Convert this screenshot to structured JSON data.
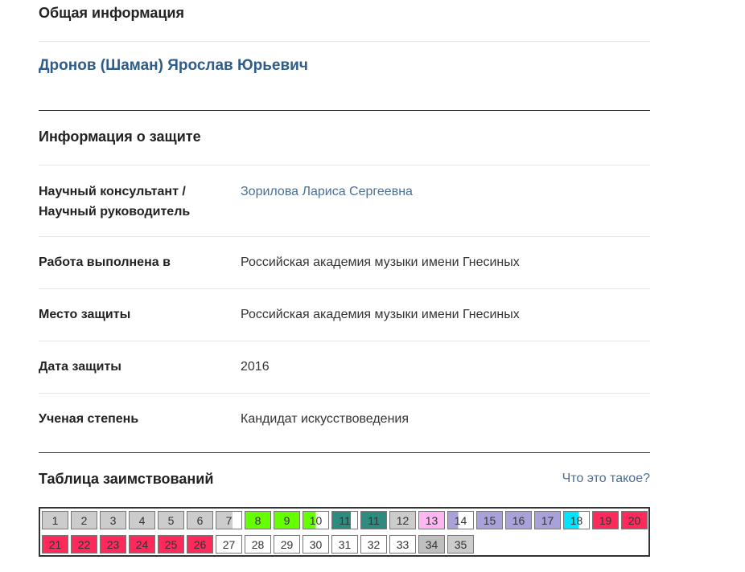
{
  "general": {
    "title": "Общая информация",
    "person_name": "Дронов (Шаман) Ярослав Юрьевич"
  },
  "defense": {
    "title": "Информация о защите",
    "rows": [
      {
        "label_1": "Научный консультант /",
        "label_2": "Научный руководитель",
        "value": "Зорилова Лариса Сергеевна",
        "is_link": true
      },
      {
        "label": "Работа выполнена в",
        "value": "Российская академия музыки имени Гнесиных"
      },
      {
        "label": "Место защиты",
        "value": "Российская академия музыки имени Гнесиных"
      },
      {
        "label": "Дата защиты",
        "value": "2016"
      },
      {
        "label": "Ученая степень",
        "value": "Кандидат искусствоведения"
      }
    ]
  },
  "borrowings": {
    "title": "Таблица заимствований",
    "help_link": "Что это такое?",
    "cells": [
      {
        "n": "1",
        "color": "#cccccc",
        "fill": 1
      },
      {
        "n": "2",
        "color": "#cccccc",
        "fill": 1
      },
      {
        "n": "3",
        "color": "#cccccc",
        "fill": 1
      },
      {
        "n": "4",
        "color": "#cccccc",
        "fill": 1
      },
      {
        "n": "5",
        "color": "#cccccc",
        "fill": 1
      },
      {
        "n": "6",
        "color": "#cccccc",
        "fill": 1
      },
      {
        "n": "7",
        "color": "#cccccc",
        "fill": 0.65
      },
      {
        "n": "8",
        "color": "#66ff00",
        "fill": 1
      },
      {
        "n": "9",
        "color": "#66ff00",
        "fill": 1
      },
      {
        "n": "10",
        "color": "#66ff00",
        "fill": 0.5
      },
      {
        "n": "11",
        "color": "#2e8b80",
        "fill": 0.75
      },
      {
        "n": "11",
        "color": "#2e8b80",
        "fill": 1
      },
      {
        "n": "12",
        "color": "#cccccc",
        "fill": 1
      },
      {
        "n": "13",
        "color": "#ffb6f2",
        "fill": 1
      },
      {
        "n": "14",
        "color": "#a9a1d9",
        "fill": 0.4
      },
      {
        "n": "15",
        "color": "#a9a1d9",
        "fill": 1
      },
      {
        "n": "16",
        "color": "#a9a1d9",
        "fill": 1
      },
      {
        "n": "17",
        "color": "#a9a1d9",
        "fill": 1
      },
      {
        "n": "18",
        "color": "#00e5ff",
        "fill": 0.6
      },
      {
        "n": "19",
        "color": "#ff2a5b",
        "fill": 1
      },
      {
        "n": "20",
        "color": "#ff2a5b",
        "fill": 1
      },
      {
        "n": "21",
        "color": "#ff2a5b",
        "fill": 1
      },
      {
        "n": "22",
        "color": "#ff2a5b",
        "fill": 1
      },
      {
        "n": "23",
        "color": "#ff2a5b",
        "fill": 1
      },
      {
        "n": "24",
        "color": "#ff2a5b",
        "fill": 1
      },
      {
        "n": "25",
        "color": "#ff2a5b",
        "fill": 1
      },
      {
        "n": "26",
        "color": "#ff2a5b",
        "fill": 1
      },
      {
        "n": "27",
        "color": "#ffffff",
        "fill": 0
      },
      {
        "n": "28",
        "color": "#ffffff",
        "fill": 0
      },
      {
        "n": "29",
        "color": "#ffffff",
        "fill": 0
      },
      {
        "n": "30",
        "color": "#ffffff",
        "fill": 0
      },
      {
        "n": "31",
        "color": "#ffffff",
        "fill": 0
      },
      {
        "n": "32",
        "color": "#ffffff",
        "fill": 0
      },
      {
        "n": "33",
        "color": "#ffffff",
        "fill": 0
      },
      {
        "n": "34",
        "color": "#bfbfbf",
        "fill": 1
      },
      {
        "n": "35",
        "color": "#cccccc",
        "fill": 1
      }
    ]
  }
}
